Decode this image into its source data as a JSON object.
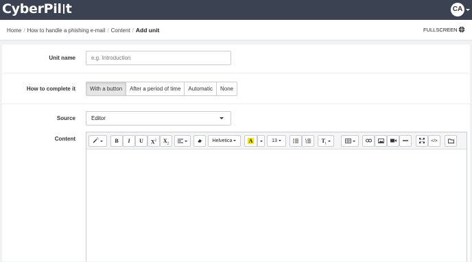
{
  "app": {
    "logo_left": "CyberPil",
    "logo_right": "t"
  },
  "user": {
    "initials": "CA"
  },
  "breadcrumb": {
    "items": [
      "Home",
      "How to handle a phishing e-mail",
      "Content",
      "Add unit"
    ],
    "separator": "/"
  },
  "header": {
    "fullscreen_label": "FULLSCREEN"
  },
  "form": {
    "unit_name": {
      "label": "Unit name",
      "placeholder": "e.g. Introduction",
      "value": ""
    },
    "how_to_complete": {
      "label": "How to complete it",
      "options": [
        "With a button",
        "After a period of time",
        "Automatic",
        "None"
      ],
      "selected": "With a button"
    },
    "source": {
      "label": "Source",
      "value": "Editor"
    },
    "content": {
      "label": "Content"
    }
  },
  "editor_toolbar": {
    "bold": "B",
    "italic": "I",
    "underline": "U",
    "superscript": "X",
    "subscript": "X",
    "font_family": "Helvetica",
    "font_size": "13",
    "text_color_glyph": "A",
    "style_glyph": "T",
    "code_glyph": "</>"
  },
  "colors": {
    "topbar": "#3b4251",
    "highlight": "#f7e600"
  }
}
